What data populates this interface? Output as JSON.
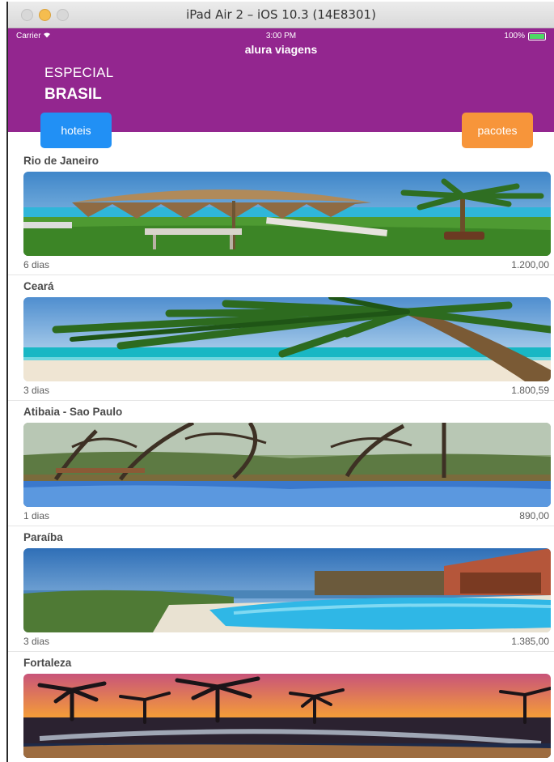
{
  "window": {
    "title": "iPad Air 2 – iOS 10.3 (14E8301)"
  },
  "status_bar": {
    "carrier": "Carrier",
    "time": "3:00 PM",
    "battery": "100%"
  },
  "nav": {
    "title": "alura viagens"
  },
  "banner": {
    "line1": "ESPECIAL",
    "line2": "BRASIL"
  },
  "buttons": {
    "hoteis": "hoteis",
    "pacotes": "pacotes"
  },
  "colors": {
    "header": "#93268f",
    "hoteis": "#2190f5",
    "pacotes": "#f7953a"
  },
  "packages": [
    {
      "title": "Rio de Janeiro",
      "days": "6 dias",
      "price": "1.200,00",
      "image": "beach-umbrella-palm"
    },
    {
      "title": "Ceará",
      "days": "3 dias",
      "price": "1.800,59",
      "image": "palm-tree-beach"
    },
    {
      "title": "Atibaia - Sao Paulo",
      "days": "1 dias",
      "price": "890,00",
      "image": "pool-forest"
    },
    {
      "title": "Paraíba",
      "days": "3 dias",
      "price": "1.385,00",
      "image": "pool-coast-resort"
    },
    {
      "title": "Fortaleza",
      "days": "",
      "price": "",
      "image": "sunset-palms-pool"
    }
  ]
}
